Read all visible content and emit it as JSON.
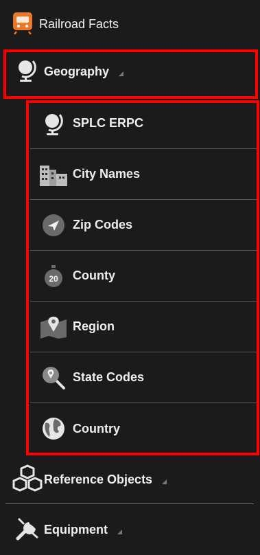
{
  "header": {
    "title": "Railroad Facts",
    "icon": "train-icon",
    "accent": "#e9782a"
  },
  "nav": {
    "geography": {
      "label": "Geography",
      "icon": "globe-icon"
    },
    "sub_items": [
      {
        "label": "SPLC ERPC",
        "icon": "globe-icon"
      },
      {
        "label": "City Names",
        "icon": "city-buildings-icon"
      },
      {
        "label": "Zip Codes",
        "icon": "location-arrow-icon"
      },
      {
        "label": "County",
        "icon": "stopwatch-20-icon"
      },
      {
        "label": "Region",
        "icon": "map-pin-icon"
      },
      {
        "label": "State Codes",
        "icon": "search-location-icon"
      },
      {
        "label": "Country",
        "icon": "earth-icon"
      }
    ],
    "reference": {
      "label": "Reference Objects",
      "icon": "cubes-icon"
    },
    "equipment": {
      "label": "Equipment",
      "icon": "tools-icon"
    }
  },
  "highlight_color": "#ff0000"
}
